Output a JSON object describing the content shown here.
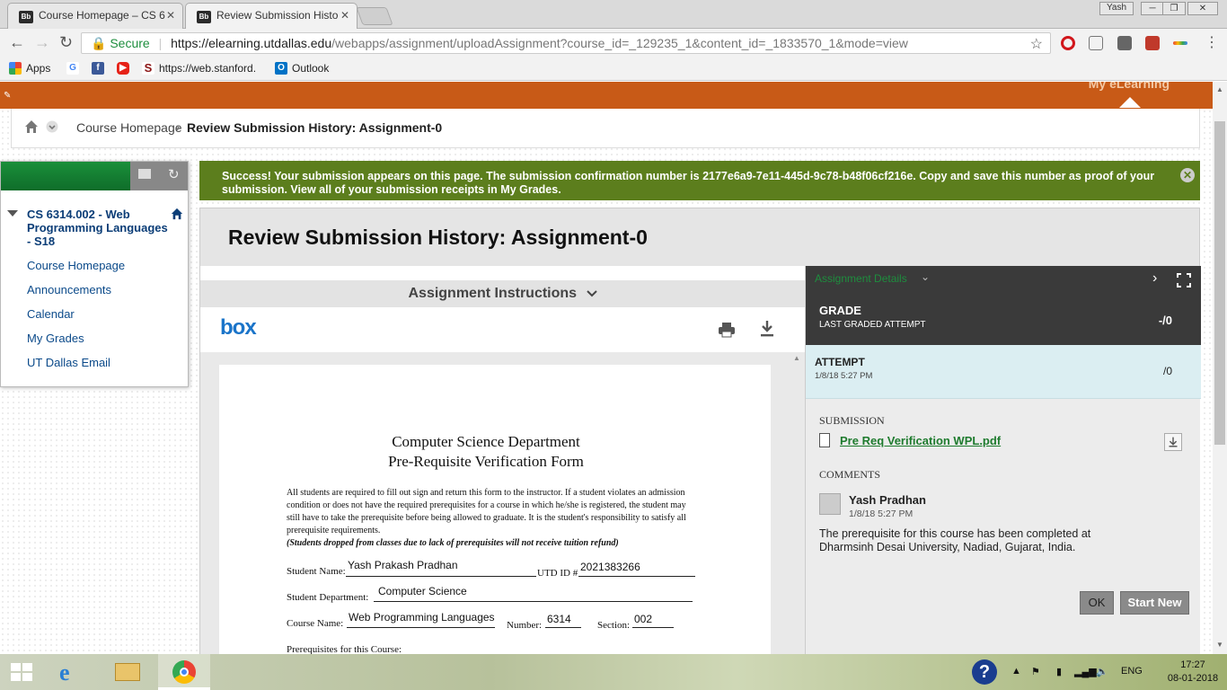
{
  "browser": {
    "tabs": [
      {
        "favicon": "Bb",
        "title": "Course Homepage – CS 6"
      },
      {
        "favicon": "Bb",
        "title": "Review Submission Histo"
      }
    ],
    "user_label": "Yash",
    "secure_label": "Secure",
    "url_host": "https://elearning.utdallas.edu",
    "url_rest": "/webapps/assignment/uploadAssignment?course_id=_129235_1&content_id=_1833570_1&mode=view",
    "bookmarks": [
      {
        "icon": "apps-grid-icon",
        "label": "Apps"
      },
      {
        "icon": "google-icon",
        "label": ""
      },
      {
        "icon": "facebook-icon",
        "label": ""
      },
      {
        "icon": "youtube-icon",
        "label": ""
      },
      {
        "icon": "stanford-icon",
        "label": "https://web.stanford."
      },
      {
        "icon": "outlook-icon",
        "label": "Outlook"
      }
    ]
  },
  "header": {
    "my_elearning": "My eLearning"
  },
  "breadcrumb": {
    "item1": "Course Homepage",
    "item2": "Review Submission History: Assignment-0"
  },
  "course_menu": {
    "course_title": "CS 6314.002 - Web Programming Languages - S18",
    "links": [
      "Course Homepage",
      "Announcements",
      "Calendar",
      "My Grades",
      "UT Dallas Email"
    ]
  },
  "success": {
    "message": "Success! Your submission appears on this page. The submission confirmation number is 2177e6a9-7e11-445d-9c78-b48f06cf216e. Copy and save this number as proof of your submission.",
    "link": "View all of your submission receipts in My Grades."
  },
  "main": {
    "title": "Review Submission History: Assignment-0",
    "instructions_label": "Assignment Instructions",
    "box_logo": "box"
  },
  "document": {
    "title1": "Computer Science Department",
    "title2": "Pre-Requisite Verification Form",
    "paragraph": "All students are required to fill out sign and return this form to the instructor. If a student violates an admission condition or does not have the required prerequisites for a course in which he/she is registered, the student may still have to take the prerequisite before being allowed to graduate. It is the student's responsibility to satisfy all prerequisite requirements.",
    "note": "(Students dropped from classes due to lack of prerequisites will not receive tuition refund)",
    "student_name_label": "Student Name:",
    "student_name": "Yash Prakash Pradhan",
    "utd_id_label": "UTD ID #",
    "utd_id": "2021383266",
    "department_label": "Student Department:",
    "department": "Computer Science",
    "course_name_label": "Course Name:",
    "course_name": "Web Programming Languages",
    "number_label": "Number:",
    "number": "6314",
    "section_label": "Section:",
    "section": "002",
    "prereq_label": "Prerequisites for this Course:"
  },
  "side_panel": {
    "details_label": "Assignment Details",
    "grade_title": "GRADE",
    "grade_sub": "LAST GRADED ATTEMPT",
    "grade_value": "-/0",
    "attempt_title": "ATTEMPT",
    "attempt_date": "1/8/18 5:27 PM",
    "attempt_value": "/0",
    "submission_label": "SUBMISSION",
    "file_name": "Pre Req Verification WPL.pdf",
    "comments_label": "COMMENTS",
    "comment_author": "Yash Pradhan",
    "comment_date": "1/8/18 5:27 PM",
    "comment_text": "The prerequisite for this course has been completed at Dharmsinh Desai University, Nadiad, Gujarat, India.",
    "ok_label": "OK",
    "start_new_label": "Start New"
  },
  "taskbar": {
    "lang": "ENG",
    "time": "17:27",
    "date": "08-01-2018"
  }
}
